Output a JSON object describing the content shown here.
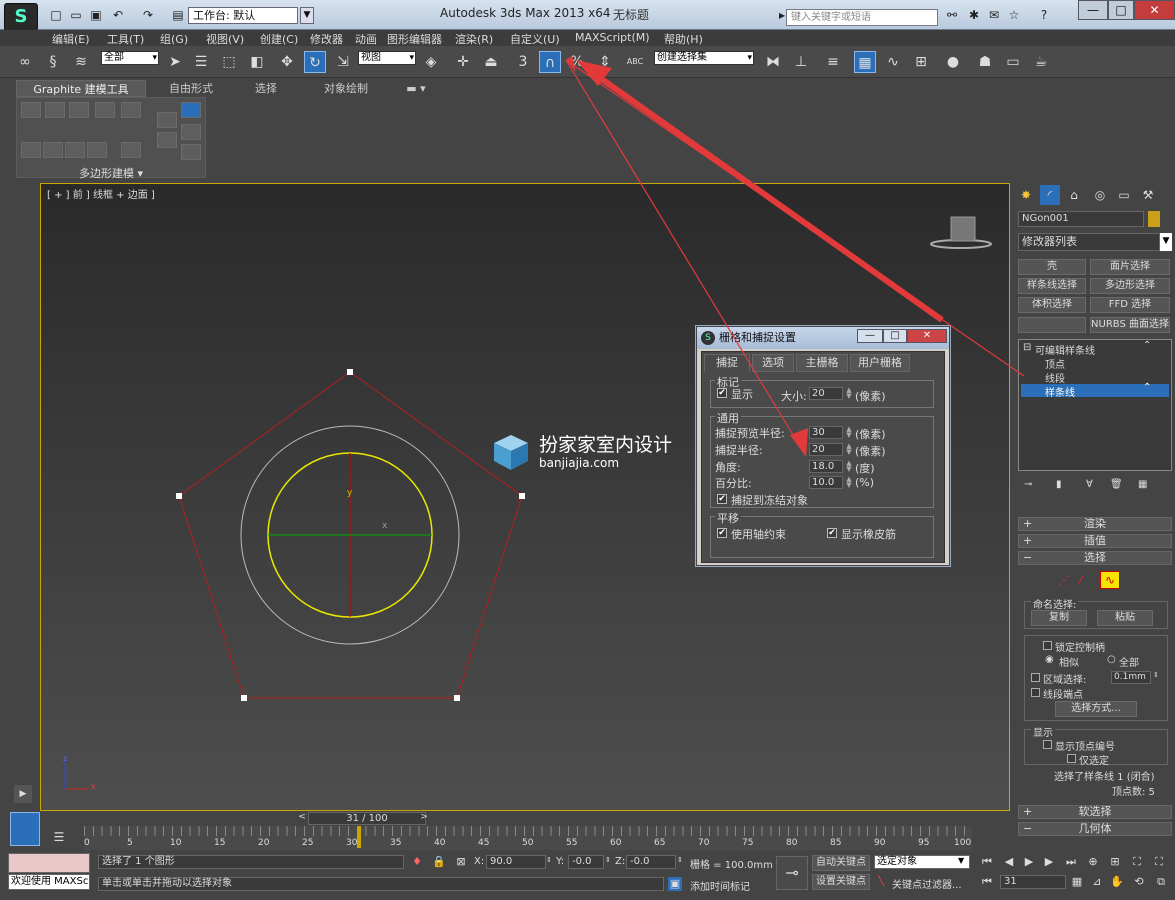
{
  "window": {
    "title": "Autodesk 3ds Max  2013 x64",
    "subtitle": "无标题",
    "workspace": "工作台: 默认",
    "search_placeholder": "键入关键字或短语"
  },
  "menu": [
    "编辑(E)",
    "工具(T)",
    "组(G)",
    "视图(V)",
    "创建(C)",
    "修改器",
    "动画",
    "图形编辑器",
    "渲染(R)",
    "自定义(U)",
    "MAXScript(M)",
    "帮助(H)"
  ],
  "toolbar": {
    "selection_filter": "全部",
    "ref_coord": "视图",
    "named_selection": "创建选择集",
    "snap_label": "3",
    "percent_label": "%",
    "spinner_label": "ABC"
  },
  "ribbon": {
    "tabs": [
      "Graphite 建模工具",
      "自由形式",
      "选择",
      "对象绘制"
    ],
    "panel_label": "多边形建模"
  },
  "viewport": {
    "label": "[ + ] 前 ] 线框 + 边面 ]",
    "axis_y": "y",
    "axis_x": "x",
    "axis_z": "z"
  },
  "watermark": {
    "cn": "扮家家室内设计",
    "en": "banjiajia.com"
  },
  "dialog": {
    "title": "栅格和捕捉设置",
    "tabs": [
      "捕捉",
      "选项",
      "主栅格",
      "用户栅格"
    ],
    "marker_group": "标记",
    "display_label": "显示",
    "size_label": "大小:",
    "size_value": "20",
    "size_unit": "(像素)",
    "general_group": "通用",
    "preview_radius_label": "捕捉预览半径:",
    "preview_radius_value": "30",
    "preview_radius_unit": "(像素)",
    "snap_radius_label": "捕捉半径:",
    "snap_radius_value": "20",
    "snap_radius_unit": "(像素)",
    "angle_label": "角度:",
    "angle_value": "18.0",
    "angle_unit": "(度)",
    "percent_label": "百分比:",
    "percent_value": "10.0",
    "percent_unit": "(%)",
    "snap_frozen_label": "捕捉到冻结对象",
    "translate_group": "平移",
    "axis_constraint_label": "使用轴约束",
    "rubber_band_label": "显示橡皮筋"
  },
  "command_panel": {
    "object_name": "NGon001",
    "modifier_list": "修改器列表",
    "buttons": [
      "壳",
      "面片选择",
      "样条线选择",
      "多边形选择",
      "体积选择",
      "FFD 选择",
      "",
      "NURBS 曲面选择"
    ],
    "stack": {
      "root": "可编辑样条线",
      "vertex": "顶点",
      "segment": "线段",
      "spline": "样条线"
    },
    "rollouts": {
      "render": "渲染",
      "interpolation": "插值",
      "selection": "选择",
      "soft_selection": "软选择",
      "geometry": "几何体"
    },
    "selection": {
      "named_sel": "命名选择:",
      "copy": "复制",
      "paste": "粘贴",
      "lock_handles": "锁定控制柄",
      "similar": "相似",
      "all": "全部",
      "area_sel": "区域选择:",
      "area_value": "0.1mm",
      "segment_end": "线段端点",
      "select_by": "选择方式...",
      "display": "显示",
      "show_vertex_num": "显示顶点编号",
      "selected_only": "仅选定",
      "status": "选择了样条线 1 (闭合)",
      "vertex_count": "顶点数: 5"
    }
  },
  "timeline": {
    "frame": "31 / 100",
    "ticks": [
      "0",
      "5",
      "10",
      "15",
      "20",
      "25",
      "30",
      "35",
      "40",
      "45",
      "50",
      "55",
      "60",
      "65",
      "70",
      "75",
      "80",
      "85",
      "90",
      "95",
      "100"
    ]
  },
  "status": {
    "script_listener": "欢迎使用 MAXSc",
    "selected": "选择了 1 个图形",
    "prompt": "单击或单击并拖动以选择对象",
    "x_label": "X:",
    "x_value": "90.0",
    "y_label": "Y:",
    "y_value": "-0.0",
    "z_label": "Z:",
    "z_value": "-0.0",
    "grid": "栅格 = 100.0mm",
    "auto_key": "自动关键点",
    "set_key": "设置关键点",
    "key_mode": "选定对象",
    "key_filter": "关键点过滤器...",
    "add_time_tag": "添加时间标记",
    "current_frame": "31"
  },
  "colors": {
    "accent": "#2b6fb8",
    "viewport_border": "#c8a800",
    "spline": "#b02020",
    "circle": "#e8e800",
    "arrow": "#e23a3a"
  }
}
